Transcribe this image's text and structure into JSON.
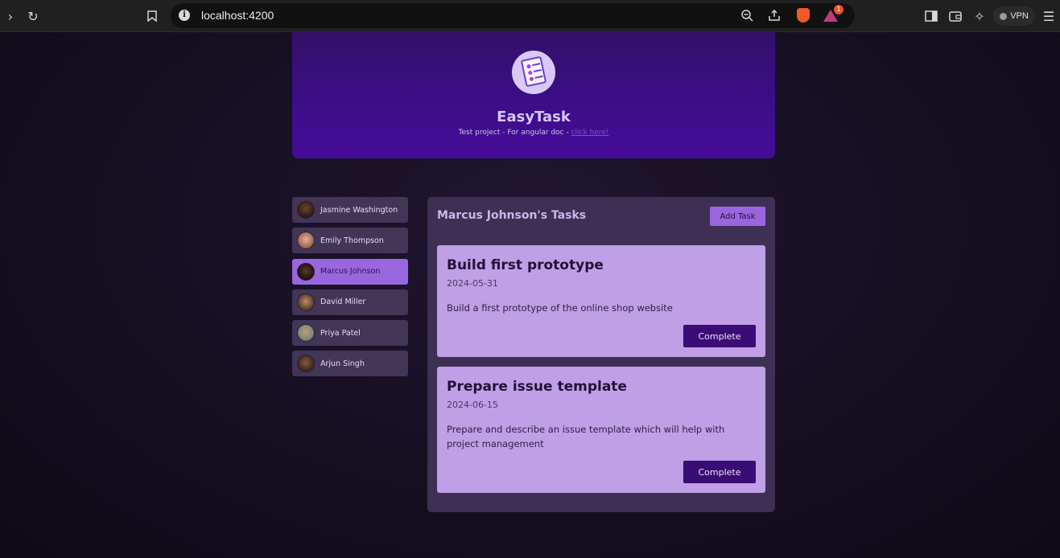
{
  "browser": {
    "url": "localhost:4200",
    "notification_count": "1",
    "vpn_label": "VPN"
  },
  "header": {
    "title": "EasyTask",
    "subtitle": "Test project - For angular doc - ",
    "link_text": "click here!"
  },
  "users": [
    {
      "name": "Jasmine Washington",
      "avatar_color": "#3a2418",
      "active": false
    },
    {
      "name": "Emily Thompson",
      "avatar_color": "#b07a62",
      "active": false
    },
    {
      "name": "Marcus Johnson",
      "avatar_color": "#2b1a12",
      "active": true
    },
    {
      "name": "David Miller",
      "avatar_color": "#6b4a36",
      "active": false
    },
    {
      "name": "Priya Patel",
      "avatar_color": "#7a8a7a",
      "active": false
    },
    {
      "name": "Arjun Singh",
      "avatar_color": "#4a3024",
      "active": false
    }
  ],
  "tasks_panel": {
    "title": "Marcus Johnson's Tasks",
    "add_label": "Add Task",
    "tasks": [
      {
        "title": "Build first prototype",
        "date": "2024-05-31",
        "description": "Build a first prototype of the online shop website",
        "complete_label": "Complete"
      },
      {
        "title": "Prepare issue template",
        "date": "2024-06-15",
        "description": "Prepare and describe an issue template which will help with project management",
        "complete_label": "Complete"
      }
    ]
  },
  "colors": {
    "accent": "#9a66e0",
    "header": "#3b0e86",
    "task_card": "#c09fe6",
    "complete_button": "#3a0c76"
  }
}
